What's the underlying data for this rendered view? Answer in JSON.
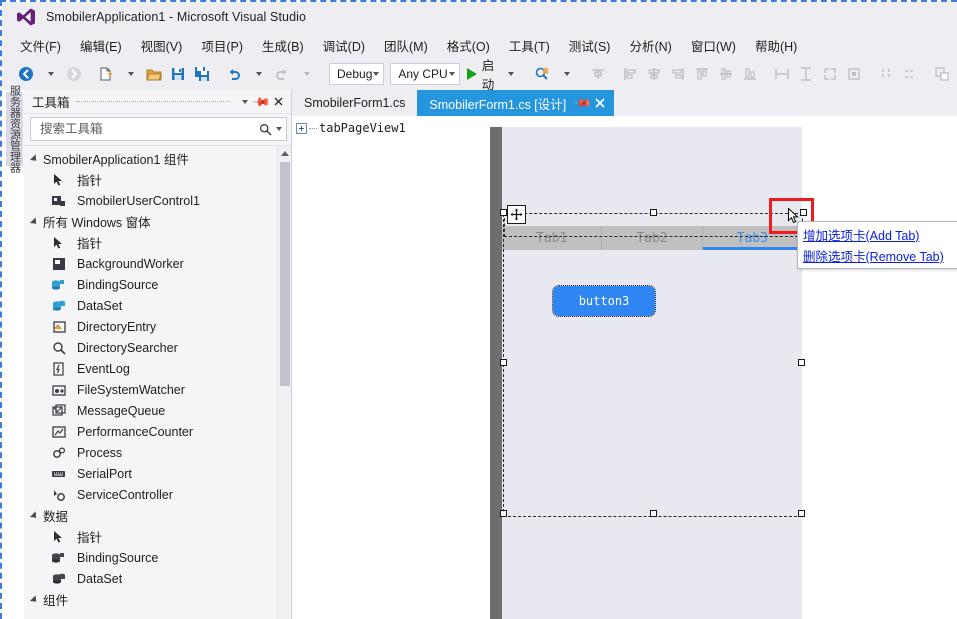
{
  "window": {
    "title": "SmobilerApplication1 - Microsoft Visual Studio",
    "logo_icon": "visual-studio-logo"
  },
  "menubar": {
    "items": [
      {
        "label": "文件(F)"
      },
      {
        "label": "编辑(E)"
      },
      {
        "label": "视图(V)"
      },
      {
        "label": "项目(P)"
      },
      {
        "label": "生成(B)"
      },
      {
        "label": "调试(D)"
      },
      {
        "label": "团队(M)"
      },
      {
        "label": "格式(O)"
      },
      {
        "label": "工具(T)"
      },
      {
        "label": "测试(S)"
      },
      {
        "label": "分析(N)"
      },
      {
        "label": "窗口(W)"
      },
      {
        "label": "帮助(H)"
      }
    ]
  },
  "toolbar": {
    "nav_back_icon": "navigate-back-icon",
    "nav_forward_icon": "navigate-forward-icon",
    "new_item_icon": "new-item-icon",
    "open_file_icon": "open-file-icon",
    "save_icon": "save-icon",
    "save_all_icon": "save-all-icon",
    "undo_icon": "undo-icon",
    "redo_icon": "redo-icon",
    "configuration": "Debug",
    "platform": "Any CPU",
    "start_label": "启动",
    "start_icon": "play-icon",
    "find_icon": "find-in-files-icon",
    "layout_icons": [
      "align-to-grid-icon",
      "align-lefts-icon",
      "align-centers-icon",
      "align-rights-icon",
      "align-tops-icon",
      "align-middles-icon",
      "align-bottoms-icon",
      "make-same-width-icon",
      "make-same-height-icon",
      "size-to-grid-icon",
      "lock-controls-icon",
      "horizontal-spacing-icon",
      "vertical-spacing-icon",
      "bring-to-front-icon",
      "send-to-back-icon"
    ],
    "overflow_icon": "toolbar-overflow-icon"
  },
  "left_dock": {
    "tab_label": "服务器资源管理器"
  },
  "toolbox": {
    "title": "工具箱",
    "dropdown_icon": "chevron-down-icon",
    "pin_icon": "pin-icon",
    "close_icon": "close-icon",
    "search_placeholder": "搜索工具箱",
    "search_value": "",
    "search_icon": "search-icon",
    "search_dropdown_icon": "chevron-down-icon",
    "groups": [
      {
        "label": "SmobilerApplication1 组件",
        "items": [
          {
            "label": "指针",
            "icon": "pointer-icon"
          },
          {
            "label": "SmobilerUserControl1",
            "icon": "user-control-icon"
          }
        ]
      },
      {
        "label": "所有 Windows 窗体",
        "items": [
          {
            "label": "指针",
            "icon": "pointer-icon"
          },
          {
            "label": "BackgroundWorker",
            "icon": "background-worker-icon"
          },
          {
            "label": "BindingSource",
            "icon": "binding-source-icon"
          },
          {
            "label": "DataSet",
            "icon": "dataset-icon"
          },
          {
            "label": "DirectoryEntry",
            "icon": "directory-entry-icon"
          },
          {
            "label": "DirectorySearcher",
            "icon": "directory-searcher-icon"
          },
          {
            "label": "EventLog",
            "icon": "event-log-icon"
          },
          {
            "label": "FileSystemWatcher",
            "icon": "file-system-watcher-icon"
          },
          {
            "label": "MessageQueue",
            "icon": "message-queue-icon"
          },
          {
            "label": "PerformanceCounter",
            "icon": "performance-counter-icon"
          },
          {
            "label": "Process",
            "icon": "process-icon"
          },
          {
            "label": "SerialPort",
            "icon": "serial-port-icon"
          },
          {
            "label": "ServiceController",
            "icon": "service-controller-icon"
          }
        ]
      },
      {
        "label": "数据",
        "items": [
          {
            "label": "指针",
            "icon": "pointer-icon"
          },
          {
            "label": "BindingSource",
            "icon": "binding-source-icon"
          },
          {
            "label": "DataSet",
            "icon": "dataset-icon"
          }
        ]
      },
      {
        "label": "组件",
        "items": []
      }
    ],
    "scroll_up_icon": "scroll-up-arrow-icon"
  },
  "document_tabs": {
    "tabs": [
      {
        "label": "SmobilerForm1.cs",
        "active": false
      },
      {
        "label": "SmobilerForm1.cs [设计]",
        "active": true
      }
    ],
    "pin_icon": "pin-icon",
    "close_icon": "close-icon"
  },
  "designer": {
    "tree_item": "tabPageView1",
    "expand_icon": "expand-plus-icon",
    "move_handle_icon": "move-handle-icon",
    "form_tabs": [
      {
        "label": "Tab1",
        "active": false
      },
      {
        "label": "Tab2",
        "active": false
      },
      {
        "label": "Tab3",
        "active": true
      }
    ],
    "button": {
      "label": "button3"
    },
    "colors": {
      "accent_blue": "#2f86f2",
      "tabbar_gray": "#c0c0c0",
      "form_background": "#e8e8f0",
      "canvas_gray": "#6e6e6e",
      "highlight_red": "#ee1c1c"
    }
  },
  "context_menu": {
    "items": [
      {
        "label": "增加选项卡(Add Tab)"
      },
      {
        "label": "删除选项卡(Remove Tab)"
      }
    ]
  },
  "cursor": {
    "icon": "arrow-pointer-icon"
  }
}
